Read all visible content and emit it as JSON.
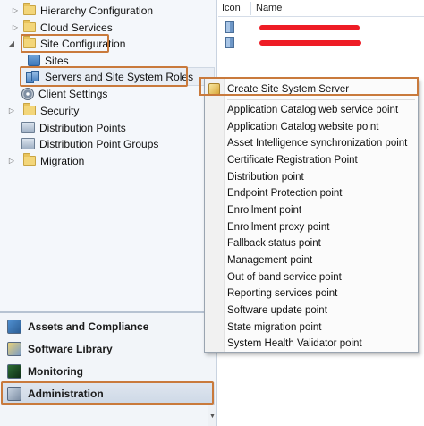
{
  "tree": {
    "items": [
      {
        "label": "Hierarchy Configuration"
      },
      {
        "label": "Cloud Services"
      },
      {
        "label": "Site Configuration"
      },
      {
        "label": "Sites"
      },
      {
        "label": "Servers and Site System Roles"
      },
      {
        "label": "Client Settings"
      },
      {
        "label": "Security"
      },
      {
        "label": "Distribution Points"
      },
      {
        "label": "Distribution Point Groups"
      },
      {
        "label": "Migration"
      }
    ]
  },
  "workspaces": {
    "items": [
      {
        "label": "Assets and Compliance"
      },
      {
        "label": "Software Library"
      },
      {
        "label": "Monitoring"
      },
      {
        "label": "Administration"
      }
    ]
  },
  "grid": {
    "columns": [
      {
        "label": "Icon"
      },
      {
        "label": "Name"
      }
    ]
  },
  "context_menu": {
    "create_label": "Create Site System Server",
    "items": [
      {
        "label": "Application Catalog web service point"
      },
      {
        "label": "Application Catalog website point"
      },
      {
        "label": "Asset Intelligence synchronization point"
      },
      {
        "label": "Certificate Registration Point"
      },
      {
        "label": "Distribution point"
      },
      {
        "label": "Endpoint Protection point"
      },
      {
        "label": "Enrollment point"
      },
      {
        "label": "Enrollment proxy point"
      },
      {
        "label": "Fallback status point"
      },
      {
        "label": "Management point"
      },
      {
        "label": "Out of band service point"
      },
      {
        "label": "Reporting services point"
      },
      {
        "label": "Software update point"
      },
      {
        "label": "State migration point"
      },
      {
        "label": "System Health Validator point"
      }
    ]
  },
  "colors": {
    "highlight_border": "#c97a3c",
    "redaction": "#ee1c25"
  }
}
